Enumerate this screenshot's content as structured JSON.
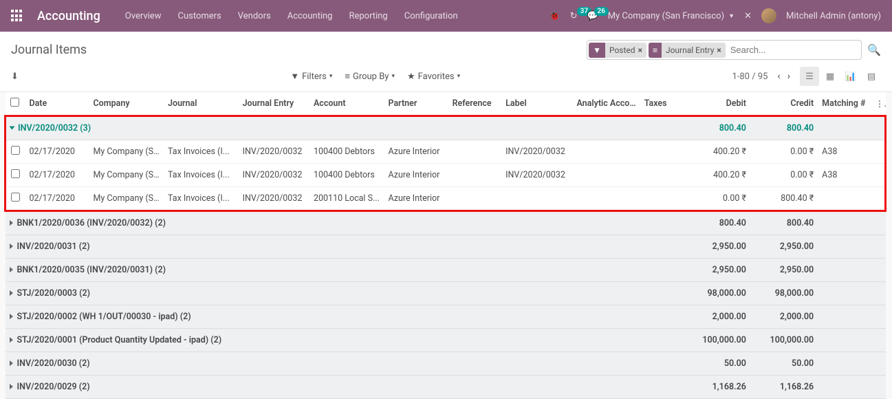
{
  "nav": {
    "app_title": "Accounting",
    "links": [
      "Overview",
      "Customers",
      "Vendors",
      "Accounting",
      "Reporting",
      "Configuration"
    ],
    "debug_badge": "37",
    "chat_badge": "26",
    "company": "My Company (San Francisco)",
    "user": "Mitchell Admin (antony)"
  },
  "breadcrumb": "Journal Items",
  "search": {
    "facets": [
      {
        "icon": "filter",
        "label": "Posted"
      },
      {
        "icon": "group",
        "label": "Journal Entry"
      }
    ],
    "placeholder": "Search..."
  },
  "toolbar": {
    "filters": "Filters",
    "groupby": "Group By",
    "favorites": "Favorites",
    "pager": "1-80 / 95"
  },
  "columns": {
    "date": "Date",
    "company": "Company",
    "journal": "Journal",
    "je": "Journal Entry",
    "account": "Account",
    "partner": "Partner",
    "ref": "Reference",
    "label": "Label",
    "analytic": "Analytic Acco...",
    "taxes": "Taxes",
    "debit": "Debit",
    "credit": "Credit",
    "match": "Matching #"
  },
  "groups": [
    {
      "expanded": true,
      "name": "INV/2020/0032 (3)",
      "debit": "800.40",
      "credit": "800.40",
      "rows": [
        {
          "date": "02/17/2020",
          "company": "My Company (S...",
          "journal": "Tax Invoices (I...",
          "je": "INV/2020/0032",
          "account": "100400 Debtors",
          "partner": "Azure Interior",
          "ref": "",
          "label": "INV/2020/0032",
          "analytic": "",
          "taxes": "",
          "debit": "400.20 ₹",
          "credit": "0.00 ₹",
          "match": "A38"
        },
        {
          "date": "02/17/2020",
          "company": "My Company (S...",
          "journal": "Tax Invoices (I...",
          "je": "INV/2020/0032",
          "account": "100400 Debtors",
          "partner": "Azure Interior",
          "ref": "",
          "label": "INV/2020/0032",
          "analytic": "",
          "taxes": "",
          "debit": "400.20 ₹",
          "credit": "0.00 ₹",
          "match": "A38"
        },
        {
          "date": "02/17/2020",
          "company": "My Company (S...",
          "journal": "Tax Invoices (I...",
          "je": "INV/2020/0032",
          "account": "200110 Local S...",
          "partner": "Azure Interior",
          "ref": "",
          "label": "",
          "analytic": "",
          "taxes": "",
          "debit": "0.00 ₹",
          "credit": "800.40 ₹",
          "match": ""
        }
      ]
    },
    {
      "expanded": false,
      "name": "BNK1/2020/0036 (INV/2020/0032) (2)",
      "debit": "800.40",
      "credit": "800.40"
    },
    {
      "expanded": false,
      "name": "INV/2020/0031 (2)",
      "debit": "2,950.00",
      "credit": "2,950.00"
    },
    {
      "expanded": false,
      "name": "BNK1/2020/0035 (INV/2020/0031) (2)",
      "debit": "2,950.00",
      "credit": "2,950.00"
    },
    {
      "expanded": false,
      "name": "STJ/2020/0003 (2)",
      "debit": "98,000.00",
      "credit": "98,000.00"
    },
    {
      "expanded": false,
      "name": "STJ/2020/0002 (WH 1/OUT/00030 - ipad) (2)",
      "debit": "2,000.00",
      "credit": "2,000.00"
    },
    {
      "expanded": false,
      "name": "STJ/2020/0001 (Product Quantity Updated - ipad) (2)",
      "debit": "100,000.00",
      "credit": "100,000.00"
    },
    {
      "expanded": false,
      "name": "INV/2020/0030 (2)",
      "debit": "50.00",
      "credit": "50.00"
    },
    {
      "expanded": false,
      "name": "INV/2020/0029 (2)",
      "debit": "1,168.26",
      "credit": "1,168.26"
    }
  ]
}
